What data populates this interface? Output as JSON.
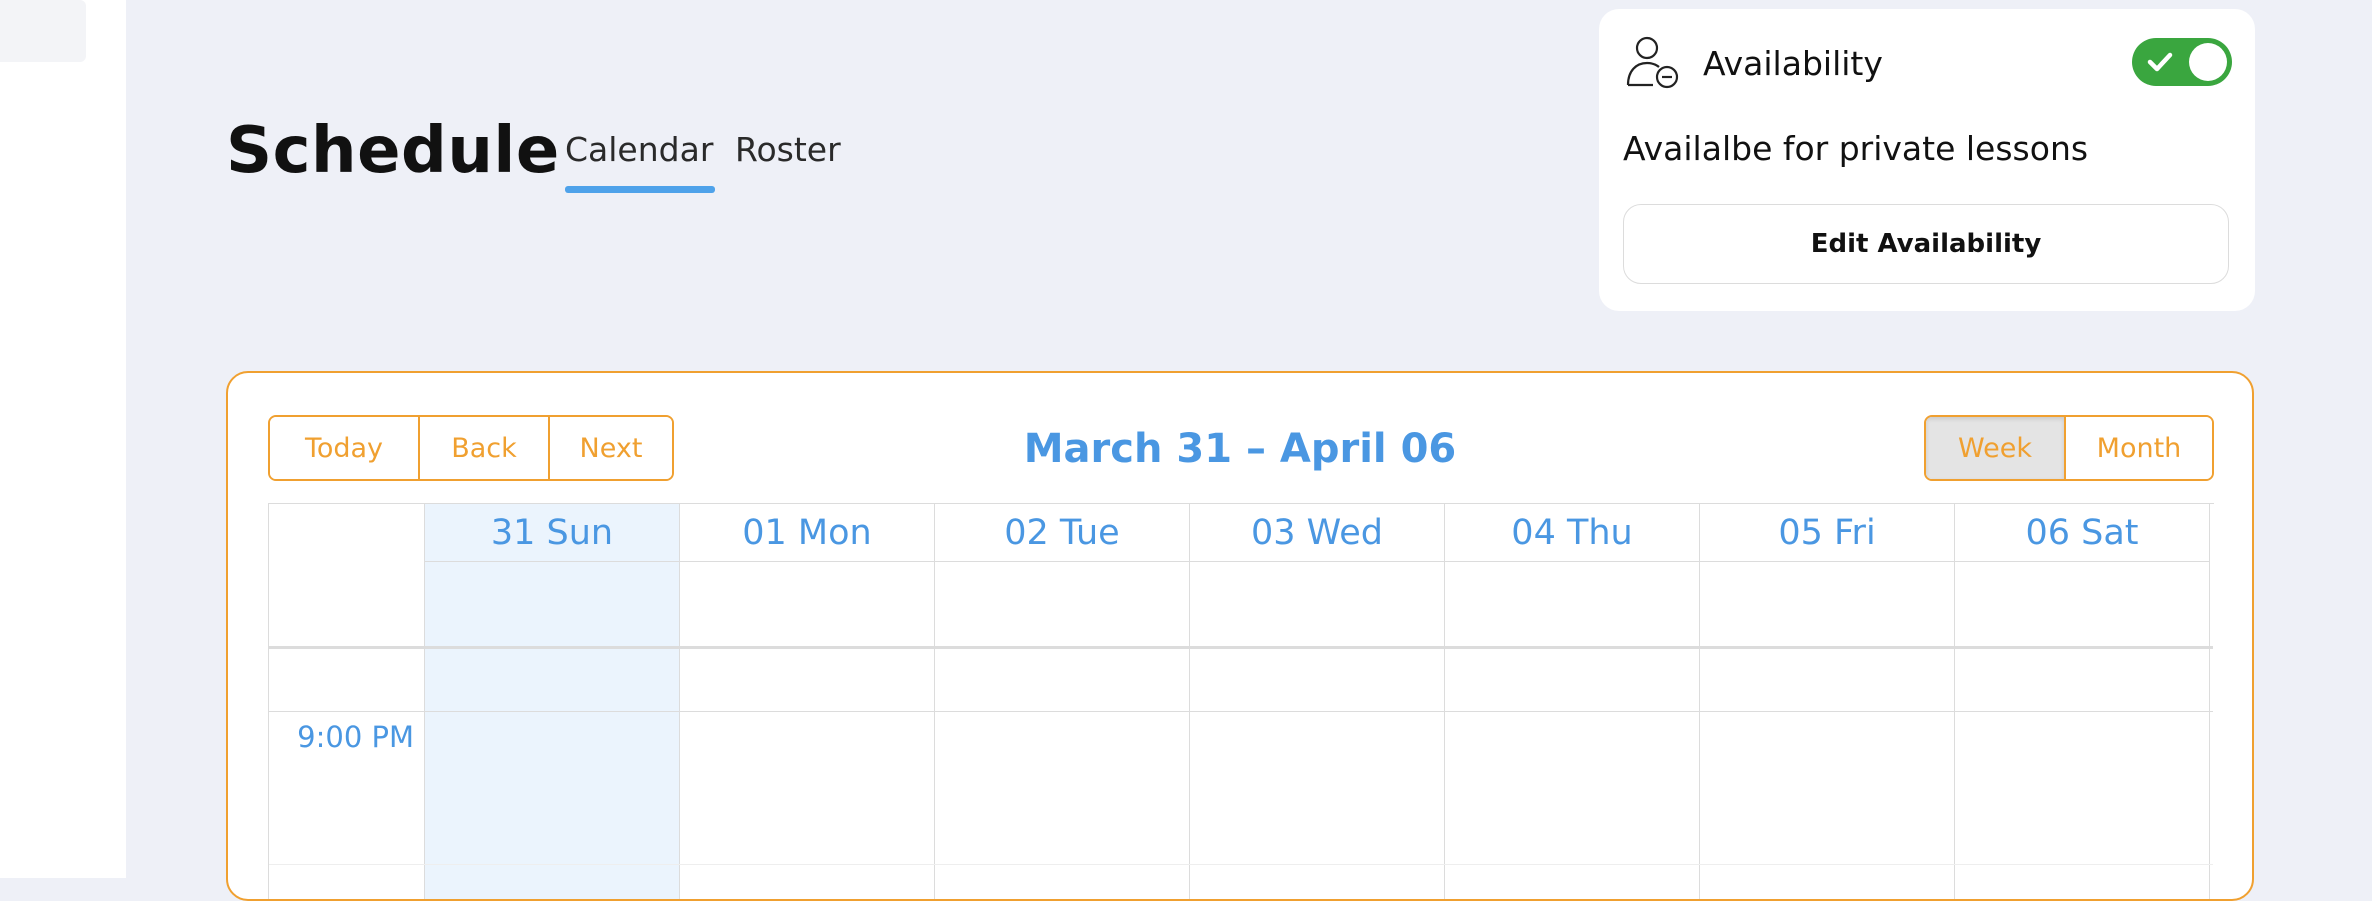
{
  "page": {
    "title": "Schedule",
    "tabs": [
      {
        "label": "Calendar",
        "active": true
      },
      {
        "label": "Roster",
        "active": false
      }
    ]
  },
  "availability": {
    "title": "Availability",
    "enabled": true,
    "description": "Availalbe for private lessons",
    "edit_button": "Edit Availability",
    "icon": "user-minus-icon",
    "toggle_color": "#3aa63f"
  },
  "calendar": {
    "toolbar": {
      "today": "Today",
      "back": "Back",
      "next": "Next",
      "range": "March 31 – April 06",
      "views": [
        {
          "label": "Week",
          "active": true
        },
        {
          "label": "Month",
          "active": false
        }
      ]
    },
    "days": [
      {
        "label": "31 Sun",
        "today": true
      },
      {
        "label": "01 Mon",
        "today": false
      },
      {
        "label": "02 Tue",
        "today": false
      },
      {
        "label": "03 Wed",
        "today": false
      },
      {
        "label": "04 Thu",
        "today": false
      },
      {
        "label": "05 Fri",
        "today": false
      },
      {
        "label": "06 Sat",
        "today": false
      }
    ],
    "time_slots": [
      "9:00 PM"
    ],
    "accent_color": "#f0a030",
    "date_color": "#4a97e2"
  }
}
